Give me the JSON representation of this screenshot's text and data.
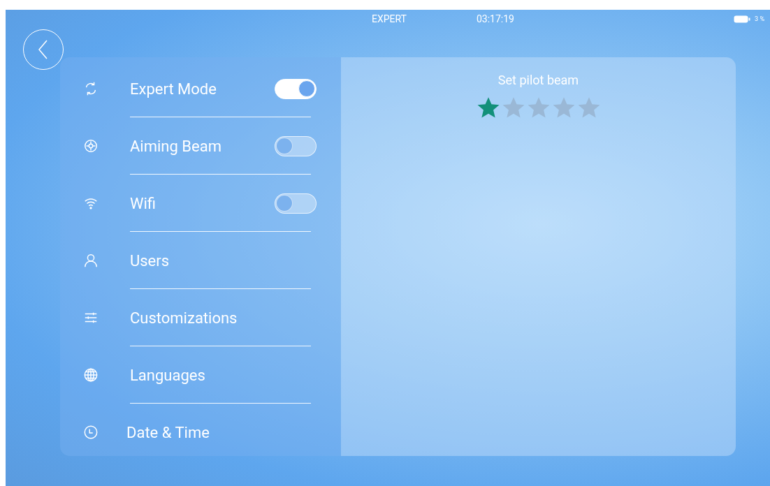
{
  "status_bar": {
    "mode": "EXPERT",
    "time": "03:17:19",
    "battery": "3 %"
  },
  "settings": [
    {
      "label": "Expert Mode",
      "kind": "toggle",
      "on": true
    },
    {
      "label": "Aiming Beam",
      "kind": "toggle",
      "on": false
    },
    {
      "label": "Wifi",
      "kind": "toggle",
      "on": false
    },
    {
      "label": "Users",
      "kind": "plain"
    },
    {
      "label": "Customizations",
      "kind": "plain"
    },
    {
      "label": "Languages",
      "kind": "plain"
    },
    {
      "label": "Date & Time",
      "kind": "plain"
    }
  ],
  "detail": {
    "title": "Set pilot beam",
    "stars": 1
  }
}
